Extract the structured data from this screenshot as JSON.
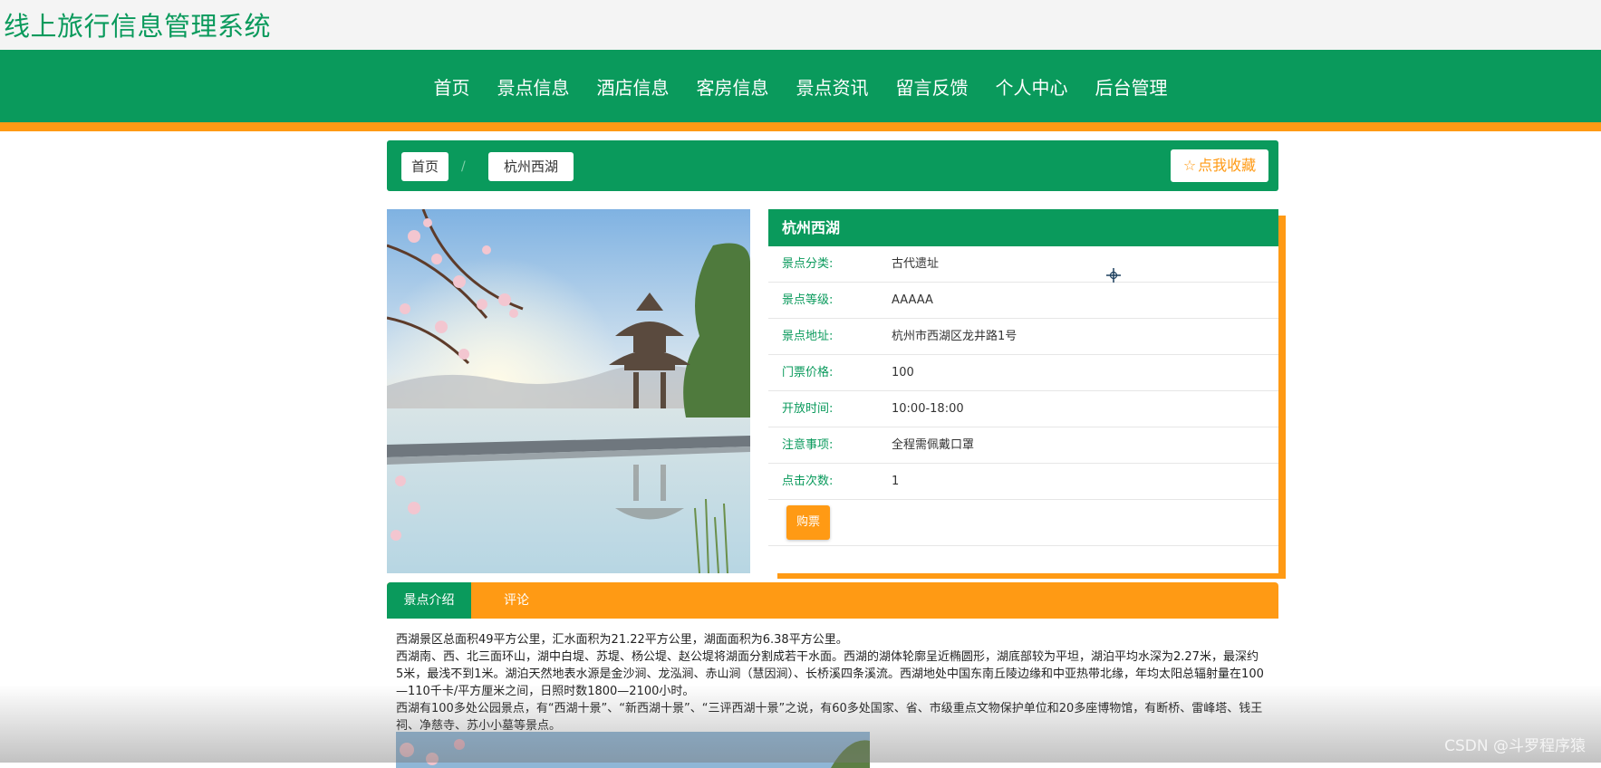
{
  "site": {
    "title": "线上旅行信息管理系统"
  },
  "nav": [
    "首页",
    "景点信息",
    "酒店信息",
    "客房信息",
    "景点资讯",
    "留言反馈",
    "个人中心",
    "后台管理"
  ],
  "breadcrumb": {
    "home": "首页",
    "separator": "/",
    "current": "杭州西湖"
  },
  "favorite": {
    "label": "点我收藏",
    "icon": "star-icon"
  },
  "detail": {
    "title": "杭州西湖",
    "fields": [
      {
        "label": "景点分类:",
        "value": "古代遗址"
      },
      {
        "label": "景点等级:",
        "value": "AAAAA"
      },
      {
        "label": "景点地址:",
        "value": "杭州市西湖区龙井路1号"
      },
      {
        "label": "门票价格:",
        "value": "100"
      },
      {
        "label": "开放时间:",
        "value": "10:00-18:00"
      },
      {
        "label": "注意事项:",
        "value": "全程需佩戴口罩"
      },
      {
        "label": "点击次数:",
        "value": "1"
      }
    ],
    "buy_label": "购票"
  },
  "tabs": [
    "景点介绍",
    "评论"
  ],
  "intro": [
    "西湖景区总面积49平方公里，汇水面积为21.22平方公里，湖面面积为6.38平方公里。",
    "西湖南、西、北三面环山，湖中白堤、苏堤、杨公堤、赵公堤将湖面分割成若干水面。西湖的湖体轮廓呈近椭圆形，湖底部较为平坦，湖泊平均水深为2.27米，最深约5米，最浅不到1米。湖泊天然地表水源是金沙涧、龙泓涧、赤山涧（慧因涧）、长桥溪四条溪流。西湖地处中国东南丘陵边缘和中亚热带北缘，年均太阳总辐射量在100—110千卡/平方厘米之间，日照时数1800—2100小时。",
    "西湖有100多处公园景点，有“西湖十景”、“新西湖十景”、“三评西湖十景”之说，有60多处国家、省、市级重点文物保护单位和20多座博物馆，有断桥、雷峰塔、钱王祠、净慈寺、苏小小墓等景点。"
  ],
  "watermark": "CSDN @斗罗程序猿",
  "colors": {
    "primary": "#0a9a5c",
    "accent": "#ff9a14"
  }
}
